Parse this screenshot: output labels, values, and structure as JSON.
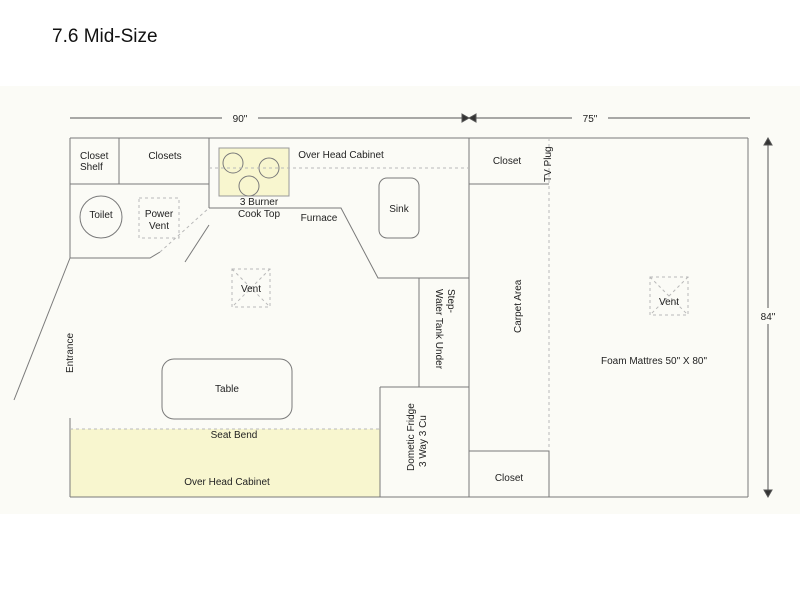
{
  "title": "7.6 Mid-Size",
  "dimensions": {
    "front_width": "90\"",
    "rear_width": "75\"",
    "length": "84\""
  },
  "labels": {
    "closet_shelf_1": "Closet",
    "closet_shelf_2": "Shelf",
    "closets": "Closets",
    "overhead_cabinet_top": "Over Head Cabinet",
    "closet_top": "Closet",
    "tv_plug": "TV Plug",
    "toilet": "Toilet",
    "power_vent_1": "Power",
    "power_vent_2": "Vent",
    "cooktop_1": "3 Burner",
    "cooktop_2": "Cook Top",
    "furnace": "Furnace",
    "sink": "Sink",
    "vent_main": "Vent",
    "step_1": "Step-",
    "step_2": "Water Tank Under",
    "carpet_area": "Carpet Area",
    "vent_bed": "Vent",
    "foam_mattress": "Foam Mattres 50\" X 80\"",
    "entrance": "Entrance",
    "table": "Table",
    "seat_bend": "Seat Bend",
    "overhead_cabinet_bottom": "Over Head Cabinet",
    "fridge_1": "Dometic Fridge",
    "fridge_2": "3 Way 3 Cu",
    "closet_bottom": "Closet"
  },
  "colors": {
    "highlight": "#f8f6cf",
    "line": "#7a7a7a",
    "dash": "#b9b9b9",
    "background": "#fbfbf6"
  }
}
